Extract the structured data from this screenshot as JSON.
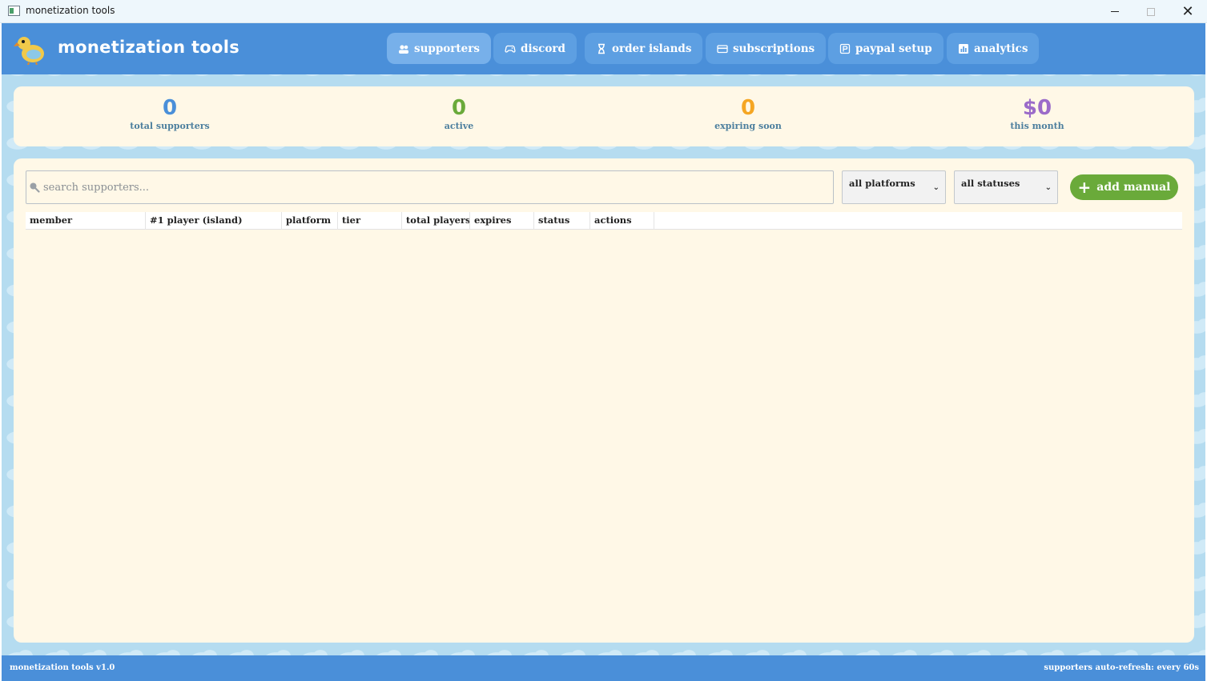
{
  "window": {
    "title": "monetization tools"
  },
  "header": {
    "brand": "monetization tools",
    "nav": [
      {
        "label": "supporters",
        "icon": "users-icon",
        "active": true
      },
      {
        "label": "discord",
        "icon": "gamepad-icon",
        "active": false
      },
      {
        "label": "order islands",
        "icon": "hourglass-icon",
        "active": false
      },
      {
        "label": "subscriptions",
        "icon": "card-icon",
        "active": false
      },
      {
        "label": "paypal setup",
        "icon": "paypal-icon",
        "active": false
      },
      {
        "label": "analytics",
        "icon": "chart-icon",
        "active": false
      }
    ]
  },
  "stats": [
    {
      "value": "0",
      "label": "total supporters",
      "color": "#4a8fd9"
    },
    {
      "value": "0",
      "label": "active",
      "color": "#6aaa3a"
    },
    {
      "value": "0",
      "label": "expiring soon",
      "color": "#f5a623"
    },
    {
      "value": "$0",
      "label": "this month",
      "color": "#9b6bc9"
    }
  ],
  "toolbar": {
    "search_placeholder": "search supporters...",
    "platform_filter": "all platforms",
    "status_filter": "all statuses",
    "add_label": "add manual"
  },
  "table": {
    "columns": [
      "member",
      "#1 player (island)",
      "platform",
      "tier",
      "total players",
      "expires",
      "status",
      "actions"
    ],
    "rows": []
  },
  "footer": {
    "version": "monetization tools v1.0",
    "refresh": "supporters auto-refresh: every 60s"
  },
  "colors": {
    "header": "#4a8fd9",
    "background": "#b5dcf0",
    "card": "#fff8e7",
    "accent_green": "#6aaa3a"
  }
}
